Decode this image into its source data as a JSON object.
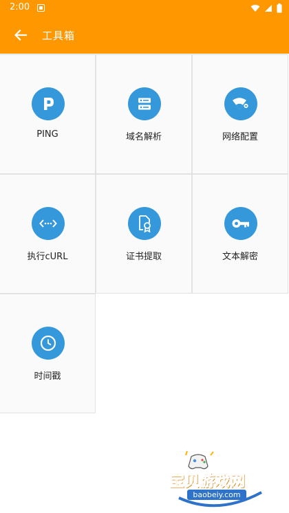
{
  "status_bar": {
    "time": "2:00"
  },
  "app_bar": {
    "title": "工具箱"
  },
  "tools": [
    {
      "label": "PING",
      "icon": "ping-icon"
    },
    {
      "label": "域名解析",
      "icon": "dns-server-icon"
    },
    {
      "label": "网络配置",
      "icon": "wifi-settings-icon"
    },
    {
      "label": "执行cURL",
      "icon": "code-brackets-icon"
    },
    {
      "label": "证书提取",
      "icon": "certificate-icon"
    },
    {
      "label": "文本解密",
      "icon": "key-icon"
    },
    {
      "label": "时间戳",
      "icon": "clock-icon"
    }
  ],
  "watermark": {
    "title": "宝贝游戏网",
    "url": "baobeiy.com"
  },
  "colors": {
    "app_bar": "#ff9800",
    "icon_circle": "#3498db"
  }
}
